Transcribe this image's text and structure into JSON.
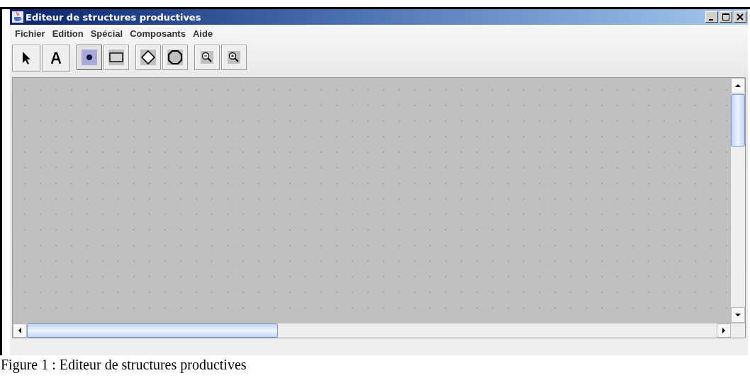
{
  "window": {
    "title": "Editeur de structures productives"
  },
  "menu": [
    "Fichier",
    "Edition",
    "Spécial",
    "Composants",
    "Aide"
  ],
  "toolbar": [
    {
      "kind": "pointer",
      "selected": false
    },
    {
      "kind": "text",
      "selected": false
    },
    {
      "kind": "node",
      "selected": true
    },
    {
      "kind": "rect",
      "selected": false
    },
    {
      "kind": "diamond",
      "selected": false
    },
    {
      "kind": "octagon",
      "selected": false
    },
    {
      "kind": "zoom-out",
      "selected": false
    },
    {
      "kind": "zoom-in",
      "selected": false
    }
  ],
  "caption": "Figure 1 : Editeur de structures productives"
}
